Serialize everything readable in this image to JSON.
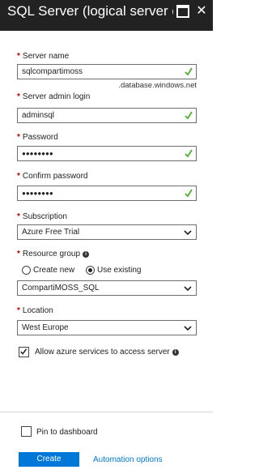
{
  "header": {
    "title": "SQL Server (logical server o..."
  },
  "form": {
    "server_name": {
      "label": "Server name",
      "value": "sqlcompartimoss",
      "suffix": ".database.windows.net"
    },
    "admin_login": {
      "label": "Server admin login",
      "value": "adminsql"
    },
    "password": {
      "label": "Password",
      "value": "●●●●●●●●"
    },
    "confirm_password": {
      "label": "Confirm password",
      "value": "●●●●●●●●"
    },
    "subscription": {
      "label": "Subscription",
      "value": "Azure Free Trial"
    },
    "resource_group": {
      "label": "Resource group",
      "options": [
        "Create new",
        "Use existing"
      ],
      "selected": "Use existing",
      "value": "CompartiMOSS_SQL"
    },
    "location": {
      "label": "Location",
      "value": "West Europe"
    },
    "allow_azure": {
      "label": "Allow azure services to access server",
      "checked": true
    }
  },
  "footer": {
    "pin_label": "Pin to dashboard",
    "create_label": "Create",
    "automation_label": "Automation options"
  },
  "colors": {
    "header_bg": "#222222",
    "required": "#c00000",
    "valid_check": "#4caf2a",
    "accent": "#0078d7"
  },
  "icons": {
    "maximize": "maximize-icon",
    "close": "close-icon",
    "valid": "checkmark-icon",
    "dropdown": "chevron-down-icon",
    "info": "info-icon"
  }
}
